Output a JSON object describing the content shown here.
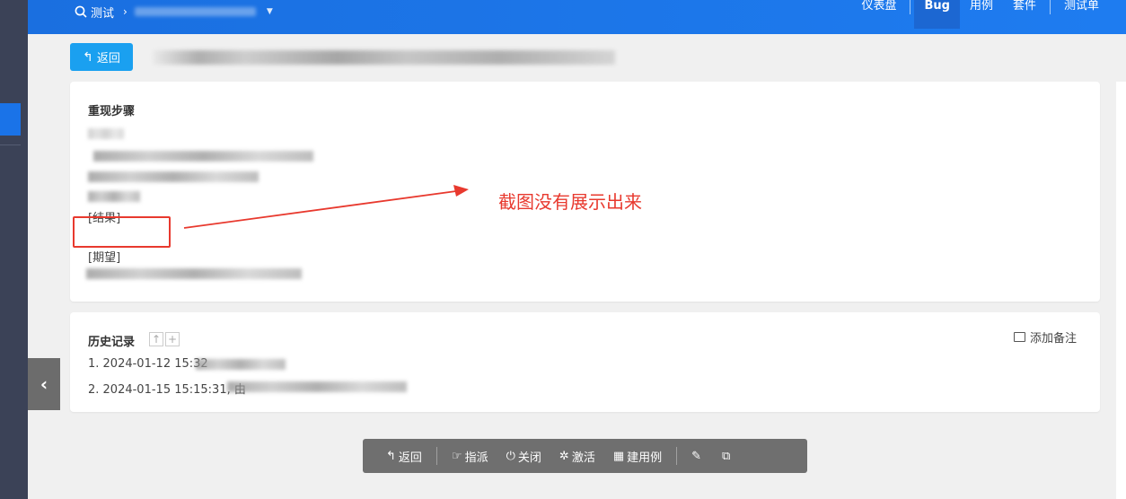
{
  "header": {
    "breadcrumb_root": "测试",
    "breadcrumb_sep": "›",
    "nav_items": [
      "仪表盘",
      "Bug",
      "用例",
      "套件",
      "测试单"
    ],
    "active_nav": "Bug"
  },
  "toolbar": {
    "back_label": "返回"
  },
  "steps_card": {
    "title": "重现步骤",
    "result_label": "[结果]",
    "expect_label": "[期望]"
  },
  "annotation": {
    "text": "截图没有展示出来",
    "color": "#e8392e"
  },
  "history": {
    "title": "历史记录",
    "add_note": "添加备注",
    "items": [
      "1. 2024-01-12 15:32",
      "2. 2024-01-15 15:15:31, 由"
    ]
  },
  "actions": {
    "back": "返回",
    "assign": "指派",
    "close": "关闭",
    "activate": "激活",
    "create_case": "建用例"
  },
  "colors": {
    "header_blue": "#1e7cf0",
    "primary_button": "#1aa0f0",
    "annotation_red": "#e8392e",
    "action_bar": "#6f6f6f"
  }
}
